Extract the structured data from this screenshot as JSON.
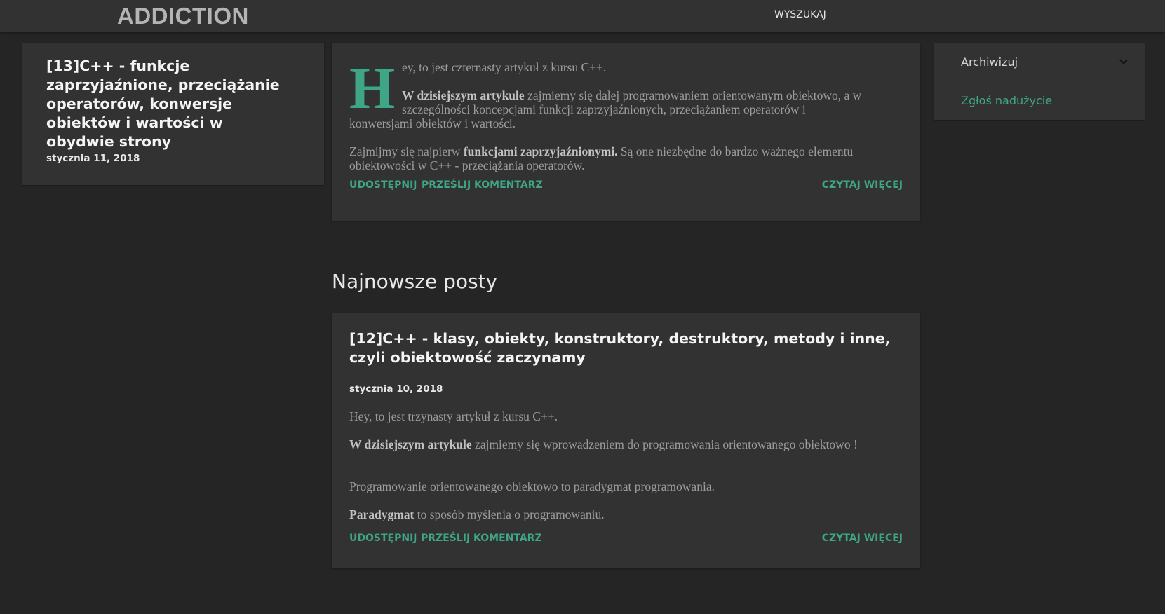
{
  "header": {
    "site_title": "ADDICTION",
    "search_label": "WYSZUKAJ"
  },
  "left_post": {
    "title": "[13]C++ - funkcje zaprzyjaźnione, przeciążanie operatorów, konwersje obiektów i wartości w obydwie strony",
    "date": "stycznia 11, 2018"
  },
  "featured_post": {
    "dropcap": "H",
    "para1": "ey, to jest czternasty artykuł z kursu C++.",
    "para2_bold": "W dzisiejszym artykule",
    "para2_line1": " zajmiemy się dalej programowaniem orientowanym obiektowo, a w szczególności koncepcjami funkcji zaprzyjaźnionych, przeciążaniem operatorów i",
    "para2_cont": "konwersjami obiektów i wartości.",
    "para3_pre": "Zajmijmy się najpierw ",
    "para3_bold": "funkcjami zaprzyjaźnionymi.",
    "para3_post": " Są one niezbędne do bardzo ważnego elementu obiektowości w C++ - przeciążania operatorów.",
    "share": "UDOSTĘPNIJ",
    "comment": "PRZEŚLIJ KOMENTARZ",
    "read_more": "CZYTAJ WIĘCEJ"
  },
  "section": {
    "heading": "Najnowsze posty"
  },
  "recent_post": {
    "title": "[12]C++ - klasy, obiekty, konstruktory, destruktory, metody i inne, czyli obiektowość zaczynamy",
    "date": "stycznia 10, 2018",
    "para1": "Hey, to jest trzynasty artykuł z kursu C++.",
    "para2_bold": "W dzisiejszym artykule",
    "para2_post": " zajmiemy się wprowadzeniem do programowania orientowanego obiektowo !",
    "para3": "Programowanie orientowanego obiektowo to paradygmat programowania.",
    "para4_bold": "Paradygmat",
    "para4_post": " to sposób myślenia o programowaniu.",
    "share": "UDOSTĘPNIJ",
    "comment": "PRZEŚLIJ KOMENTARZ",
    "read_more": "CZYTAJ WIĘCEJ"
  },
  "sidebar": {
    "archive_label": "Archiwizuj",
    "archive_icon": "chevron-down-icon",
    "report_abuse": "Zgłoś nadużycie"
  },
  "colors": {
    "background": "#252525",
    "card": "#323232",
    "accent": "#3ea586",
    "title": "#b4b4b4"
  }
}
